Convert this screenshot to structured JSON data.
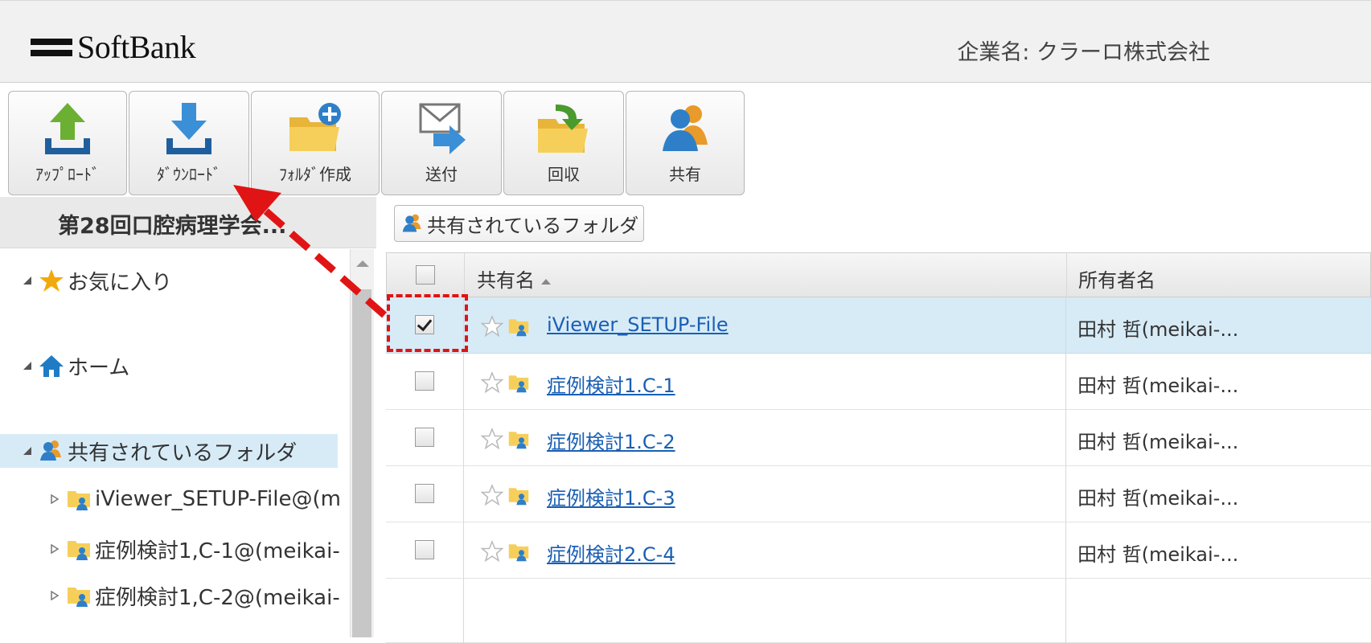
{
  "header": {
    "brand": "SoftBank",
    "company_label": "企業名: クラーロ株式会社"
  },
  "toolbar": {
    "buttons": [
      {
        "label": "ｱｯﾌﾟﾛｰﾄﾞ",
        "icon": "upload-icon"
      },
      {
        "label": "ﾀﾞｳﾝﾛｰﾄﾞ",
        "icon": "download-icon"
      },
      {
        "label": "ﾌｫﾙﾀﾞ作成",
        "icon": "folder-add-icon"
      },
      {
        "label": "送付",
        "icon": "send-mail-icon"
      },
      {
        "label": "回収",
        "icon": "folder-retrieve-icon"
      },
      {
        "label": "共有",
        "icon": "share-users-icon"
      }
    ]
  },
  "left_panel": {
    "title": "第28回口腔病理学会...",
    "tree": [
      {
        "label": "お気に入り",
        "icon": "star-icon"
      },
      {
        "label": "ホーム",
        "icon": "home-icon"
      },
      {
        "label": "共有されているフォルダ",
        "icon": "shared-users-icon",
        "selected": true
      },
      {
        "label": "iViewer_SETUP-File@(m",
        "icon": "shared-folder-icon"
      },
      {
        "label": "症例検討1,C-1@(meikai-",
        "icon": "shared-folder-icon"
      },
      {
        "label": "症例検討1,C-2@(meikai-",
        "icon": "shared-folder-icon"
      }
    ]
  },
  "breadcrumb": {
    "label": "共有されているフォルダ"
  },
  "grid": {
    "columns": [
      "共有名",
      "所有者名"
    ],
    "rows": [
      {
        "name": "iViewer_SETUP-File",
        "owner": "田村 哲(meikai-...",
        "checked": true
      },
      {
        "name": "症例検討1.C-1",
        "owner": "田村 哲(meikai-...",
        "checked": false
      },
      {
        "name": "症例検討1.C-2",
        "owner": "田村 哲(meikai-...",
        "checked": false
      },
      {
        "name": "症例検討1.C-3",
        "owner": "田村 哲(meikai-...",
        "checked": false
      },
      {
        "name": "症例検討2.C-4",
        "owner": "田村 哲(meikai-...",
        "checked": false
      }
    ]
  },
  "colors": {
    "selection": "#d7ebf7",
    "link": "#1a5fb4",
    "annotation": "#e01414"
  }
}
